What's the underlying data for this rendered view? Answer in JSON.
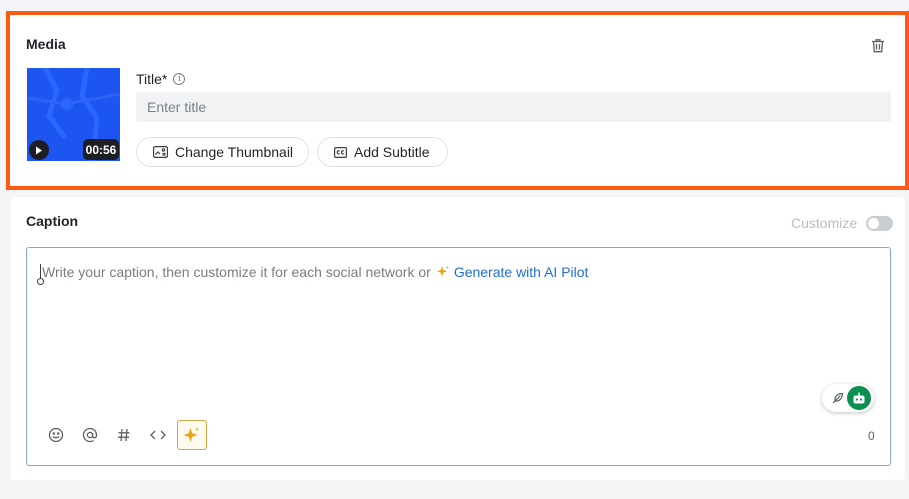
{
  "media": {
    "heading": "Media",
    "duration": "00:56",
    "title_label": "Title*",
    "title_placeholder": "Enter title",
    "title_value": "",
    "change_thumbnail_label": "Change Thumbnail",
    "add_subtitle_label": "Add Subtitle",
    "thumbnail_color": "#1d55f0",
    "highlight_color": "#fb5a12"
  },
  "caption": {
    "heading": "Caption",
    "customize_label": "Customize",
    "customize_enabled": false,
    "placeholder": "Write your caption, then customize it for each social network or",
    "ai_link": "Generate with AI Pilot",
    "char_count": "0",
    "link_color": "#1f6fd6",
    "ai_accent": "#e8a317",
    "bot_color": "#0a8f4e"
  },
  "icons": {
    "media": [
      "trash-icon",
      "play-icon",
      "thumbnail-icon",
      "closed-caption-icon",
      "info-icon"
    ],
    "toolbar": [
      "emoji-icon",
      "at-mention-icon",
      "hashtag-icon",
      "code-icon",
      "ai-sparkle-icon"
    ],
    "floating": [
      "feather-icon",
      "robot-icon"
    ]
  }
}
